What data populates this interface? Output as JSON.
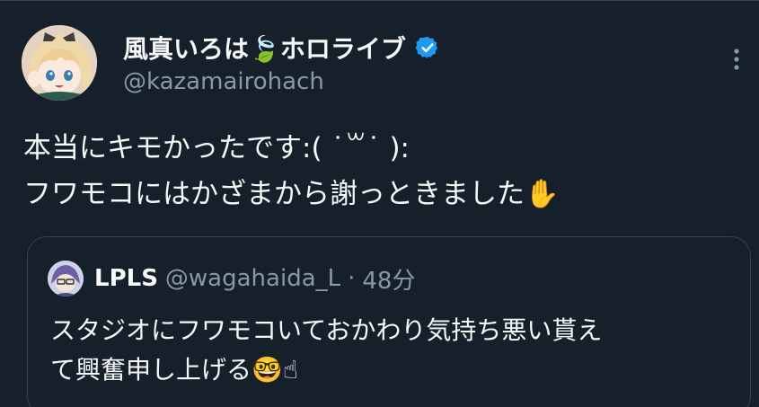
{
  "tweet": {
    "author": {
      "display_name": "風真いろは🍃ホロライブ",
      "handle": "@kazamairohach",
      "verified": true,
      "verified_color": "#1d9bf0"
    },
    "more_icon": "more-vertical-icon",
    "text_lines": [
      "本当にキモかったです:( ˙꒳˙ ):",
      "フワモコにはかざまから謝っときました✋"
    ]
  },
  "quote": {
    "author": {
      "display_name": "LPLS",
      "handle": "@wagahaida_L",
      "separator": "·",
      "time": "48分"
    },
    "text_lines": [
      "スタジオにフワモコいておかわり気持ち悪い貰え",
      "て興奮申し上げる🤓☝"
    ]
  },
  "colors": {
    "background": "#15202b",
    "text": "#f7f9f9",
    "secondary_text": "#8b98a5",
    "border": "#38444d"
  }
}
